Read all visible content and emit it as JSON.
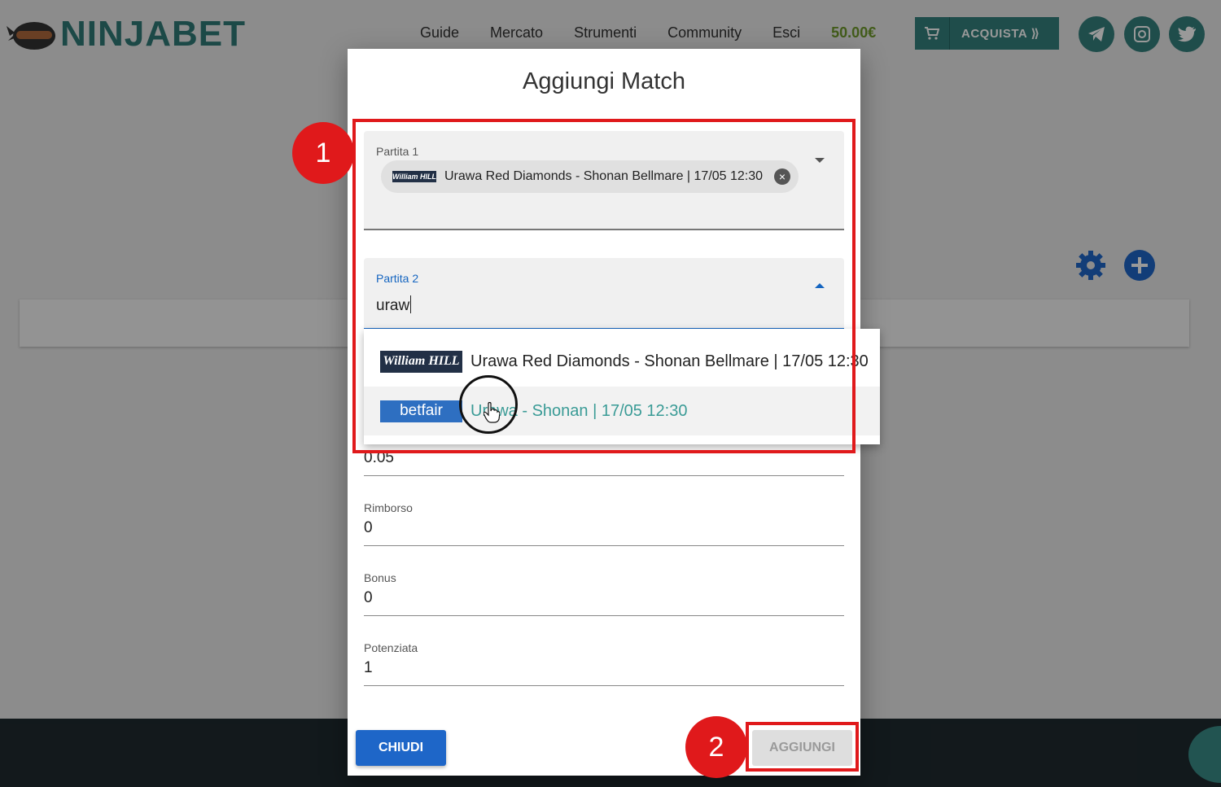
{
  "header": {
    "logo_text": "NINJABET",
    "nav": [
      "Guide",
      "Mercato",
      "Strumenti",
      "Community",
      "Esci"
    ],
    "balance": "50.00€",
    "buy_label": "ACQUISTA ⟫",
    "colors": {
      "brand": "#35807d",
      "balance": "#6f9a2c"
    }
  },
  "modal": {
    "title": "Aggiungi Match",
    "partita1": {
      "label": "Partita 1",
      "chip_logo": "William HILL",
      "chip_text": "Urawa Red Diamonds - Shonan Bellmare | 17/05 12:30"
    },
    "partita2": {
      "label": "Partita 2",
      "value": "uraw"
    },
    "commission": {
      "value": "0.05"
    },
    "rimborso": {
      "label": "Rimborso",
      "value": "0"
    },
    "bonus": {
      "label": "Bonus",
      "value": "0"
    },
    "potenziata": {
      "label": "Potenziata",
      "value": "1"
    },
    "close_label": "CHIUDI",
    "add_label": "AGGIUNGI"
  },
  "dropdown": {
    "options": [
      {
        "logo": "William HILL",
        "text": "Urawa Red Diamonds - Shonan Bellmare | 17/05 12:30"
      },
      {
        "logo": "betfair",
        "text": "Urawa - Shonan | 17/05 12:30"
      }
    ]
  },
  "annotations": {
    "step1": "1",
    "step2": "2",
    "color": "#e0191b"
  }
}
